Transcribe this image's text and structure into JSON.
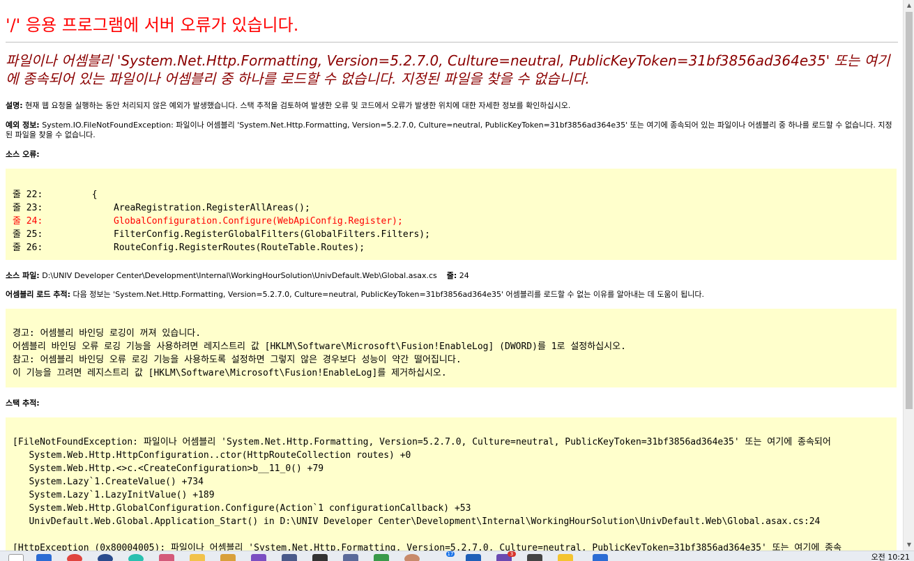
{
  "heading": "'/' 응용 프로그램에 서버 오류가 있습니다.",
  "error_title": "파일이나 어셈블리 'System.Net.Http.Formatting, Version=5.2.7.0, Culture=neutral, PublicKeyToken=31bf3856ad364e35' 또는 여기에 종속되어 있는 파일이나 어셈블리 중 하나를 로드할 수 없습니다. 지정된 파일을 찾을 수 없습니다.",
  "description": {
    "label": "설명:",
    "text": " 현재 웹 요청을 실행하는 동안 처리되지 않은 예외가 발생했습니다. 스택 추적을 검토하여 발생한 오류 및 코드에서 오류가 발생한 위치에 대한 자세한 정보를 확인하십시오."
  },
  "exception": {
    "label": "예외 정보:",
    "text": " System.IO.FileNotFoundException: 파일이나 어셈블리 'System.Net.Http.Formatting, Version=5.2.7.0, Culture=neutral, PublicKeyToken=31bf3856ad364e35' 또는 여기에 종속되어 있는 파일이나 어셈블리 중 하나를 로드할 수 없습니다. 지정된 파일을 찾을 수 없습니다."
  },
  "source_error_label": "소스 오류:",
  "source_lines": [
    {
      "text": "줄 22:         {",
      "highlight": false
    },
    {
      "text": "줄 23:             AreaRegistration.RegisterAllAreas();",
      "highlight": false
    },
    {
      "text": "줄 24:             GlobalConfiguration.Configure(WebApiConfig.Register);",
      "highlight": true
    },
    {
      "text": "줄 25:             FilterConfig.RegisterGlobalFilters(GlobalFilters.Filters);",
      "highlight": false
    },
    {
      "text": "줄 26:             RouteConfig.RegisterRoutes(RouteTable.Routes);",
      "highlight": false
    }
  ],
  "source_file": {
    "label": "소스 파일:",
    "path": " D:\\UNIV Developer Center\\Development\\Internal\\WorkingHourSolution\\UnivDefault.Web\\Global.asax.cs",
    "line_label": "줄:",
    "line_value": " 24"
  },
  "assembly_trace": {
    "label": "어셈블리 로드 추적:",
    "text": " 다음 정보는 'System.Net.Http.Formatting, Version=5.2.7.0, Culture=neutral, PublicKeyToken=31bf3856ad364e35' 어셈블리를 로드할 수 없는 이유를 알아내는 데 도움이 됩니다."
  },
  "warning_lines": [
    "경고: 어셈블리 바인딩 로깅이 꺼져 있습니다.",
    "어셈블리 바인딩 오류 로깅 기능을 사용하려면 레지스트리 값 [HKLM\\Software\\Microsoft\\Fusion!EnableLog] (DWORD)를 1로 설정하십시오.",
    "참고: 어셈블리 바인딩 오류 로깅 기능을 사용하도록 설정하면 그렇지 않은 경우보다 성능이 약간 떨어집니다.",
    "이 기능을 끄려면 레지스트리 값 [HKLM\\Software\\Microsoft\\Fusion!EnableLog]를 제거하십시오."
  ],
  "stack_trace_label": "스택 추적:",
  "stack_lines": [
    "[FileNotFoundException: 파일이나 어셈블리 'System.Net.Http.Formatting, Version=5.2.7.0, Culture=neutral, PublicKeyToken=31bf3856ad364e35' 또는 여기에 종속되어",
    "   System.Web.Http.HttpConfiguration..ctor(HttpRouteCollection routes) +0",
    "   System.Web.Http.<>c.<CreateConfiguration>b__11_0() +79",
    "   System.Lazy`1.CreateValue() +734",
    "   System.Lazy`1.LazyInitValue() +189",
    "   System.Web.Http.GlobalConfiguration.Configure(Action`1 configurationCallback) +53",
    "   UnivDefault.Web.Global.Application_Start() in D:\\UNIV Developer Center\\Development\\Internal\\WorkingHourSolution\\UnivDefault.Web\\Global.asax.cs:24",
    "",
    "[HttpException (0x80004005): 파일이나 어셈블리 'System.Net.Http.Formatting, Version=5.2.7.0, Culture=neutral, PublicKeyToken=31bf3856ad364e35' 또는 여기에 종속"
  ],
  "taskbar": {
    "badge_1": "17",
    "badge_2": "3",
    "clock": "오전 10:21"
  },
  "colors": {
    "heading": "#ff0000",
    "error_title": "#8b0000",
    "code_background": "#ffffcc",
    "highlight_line": "#ff0000"
  }
}
